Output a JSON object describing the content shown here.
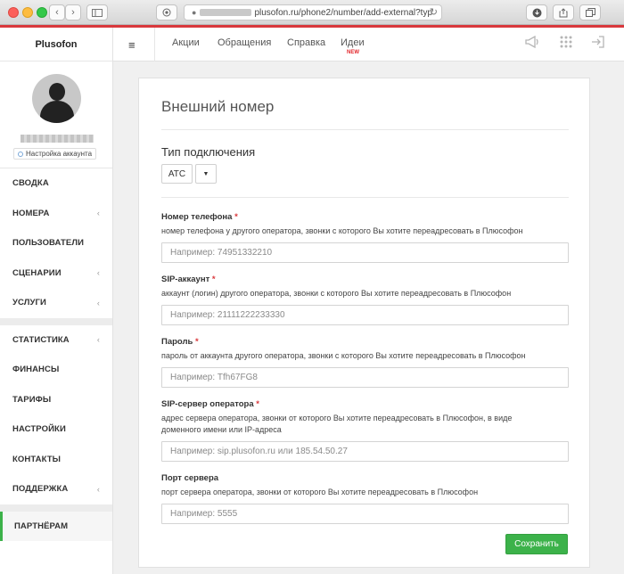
{
  "browser": {
    "url_prefix": "plusofon.ru/phone2/number/add-external?typ",
    "secure_icon": "lock-icon"
  },
  "sidebar": {
    "brand": "Plusofon",
    "profile_settings": "Настройка аккаунта",
    "menu": [
      {
        "label": "Сводка",
        "chevron": ""
      },
      {
        "label": "Номера",
        "chevron": "‹"
      },
      {
        "label": "Пользователи",
        "chevron": ""
      },
      {
        "label": "Сценарии",
        "chevron": "‹"
      },
      {
        "label": "Услуги",
        "chevron": "‹"
      }
    ],
    "menu2": [
      {
        "label": "Статистика",
        "chevron": "‹"
      },
      {
        "label": "Финансы",
        "chevron": ""
      },
      {
        "label": "Тарифы",
        "chevron": ""
      },
      {
        "label": "Настройки",
        "chevron": ""
      },
      {
        "label": "Контакты",
        "chevron": ""
      },
      {
        "label": "Поддержка",
        "chevron": "‹"
      }
    ],
    "partner": "Партнёрам"
  },
  "topnav": {
    "links": [
      "Акции",
      "Обращения",
      "Справка",
      "Идеи"
    ],
    "new_badge": "NEW"
  },
  "form": {
    "title": "Внешний номер",
    "connection_type_title": "Тип подключения",
    "connection_type_value": "АТС",
    "fields": [
      {
        "label": "Номер телефона",
        "required": "*",
        "hint": "номер телефона у другого оператора, звонки с которого Вы хотите переадресовать в Плюсофон",
        "placeholder": "Например: 74951332210"
      },
      {
        "label": "SIP-аккаунт",
        "required": "*",
        "hint": "аккаунт (логин) другого оператора, звонки с которого Вы хотите переадресовать в Плюсофон",
        "placeholder": "Например: 21111222233330"
      },
      {
        "label": "Пароль",
        "required": "*",
        "hint": "пароль от аккаунта другого оператора, звонки с которого Вы хотите переадресовать в Плюсофон",
        "placeholder": "Например: Tfh67FG8"
      },
      {
        "label": "SIP-сервер оператора",
        "required": "*",
        "hint": "адрес сервера оператора, звонки от которого Вы хотите переадресовать в Плюсофон, в виде доменного имени или IP-адреса",
        "placeholder": "Например: sip.plusofon.ru или 185.54.50.27"
      },
      {
        "label": "Порт сервера",
        "required": "",
        "hint": "порт сервера оператора, звонки от которого Вы хотите переадресовать в Плюсофон",
        "placeholder": "Например: 5555"
      }
    ],
    "save_label": "Сохранить"
  }
}
